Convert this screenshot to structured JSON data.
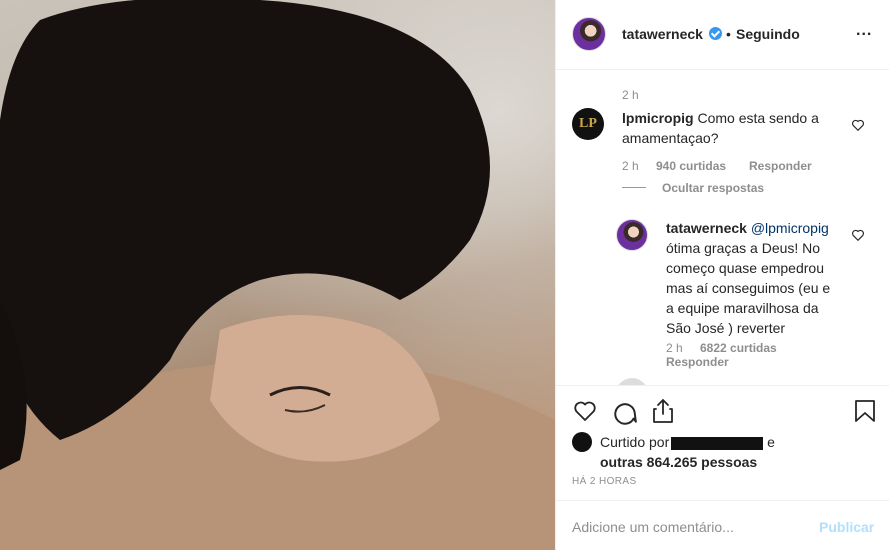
{
  "post": {
    "username": "tatawerneck",
    "separator": "•",
    "follow_status": "Seguindo",
    "more_label": "..."
  },
  "comments": {
    "top_stub_text": "·",
    "top_stub_time": "2 h",
    "c1": {
      "username": "lpmicropig",
      "text_line1": "Como esta sendo a",
      "text_line2": "amamentaçao?",
      "time": "2 h",
      "likes": "940 curtidas",
      "reply": "Responder",
      "toggle": "Ocultar respostas",
      "avatar_text": "LP"
    },
    "r1": {
      "username": "tatawerneck",
      "mention": "@lpmicropig",
      "lines": [
        "ótima graças a Deus! No",
        "começo quase empedrou",
        "mas aí conseguimos (eu e",
        "a equipe maravilhosa da",
        "São José ) reverter"
      ],
      "time": "2 h",
      "likes": "6822 curtidas",
      "reply": "Responder"
    }
  },
  "likes": {
    "prefix": "Curtido por",
    "suffix": "e",
    "line2": "outras 864.265 pessoas"
  },
  "timestamp": "HÁ 2 HORAS",
  "add_comment": {
    "placeholder": "Adicione um comentário...",
    "publish": "Publicar"
  },
  "colors": {
    "link": "#003569",
    "verified": "#3897f0",
    "publish_disabled": "#b2dffc"
  }
}
